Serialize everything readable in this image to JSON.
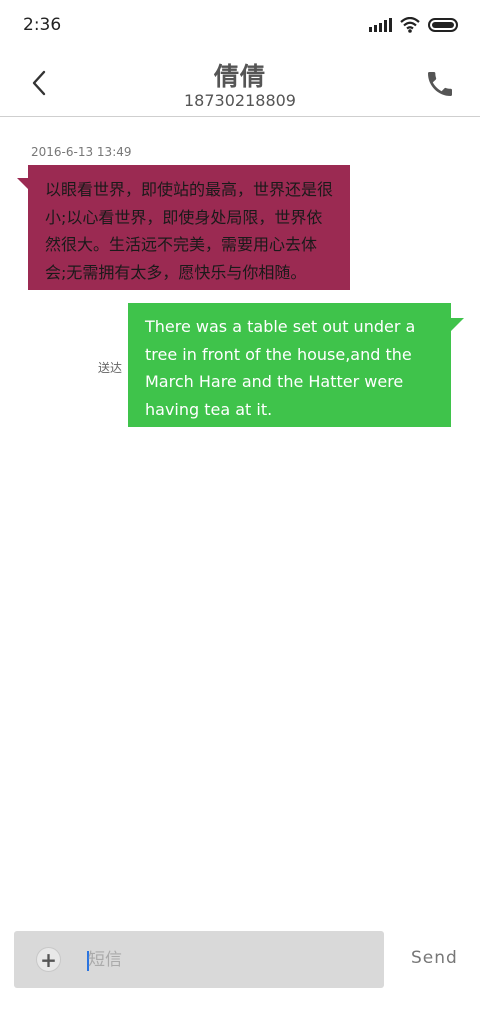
{
  "status_bar": {
    "time": "2:36",
    "icons": [
      "signal-icon",
      "wifi-icon",
      "battery-icon"
    ]
  },
  "header": {
    "contact_name": "倩倩",
    "phone_number": "18730218809",
    "icons": [
      "back-arrow-icon",
      "phone-call-icon"
    ]
  },
  "conversation": {
    "timestamp": "2016-6-13 13:49",
    "messages": [
      {
        "direction": "incoming",
        "text": "以眼看世界，即使站的最高，世界还是很小;以心看世界，即使身处局限，世界依然很大。生活远不完美，需要用心去体会;无需拥有太多，愿快乐与你相随。",
        "color": "#9b2a52"
      },
      {
        "direction": "outgoing",
        "status": "送达",
        "text": "There was a table set out under a tree in front of the house,and the March Hare and the Hatter were having tea at it.",
        "color": "#3fc34b"
      }
    ]
  },
  "composer": {
    "placeholder": "短信",
    "value": "",
    "add_icon": "plus-icon",
    "send_label": "Send"
  }
}
